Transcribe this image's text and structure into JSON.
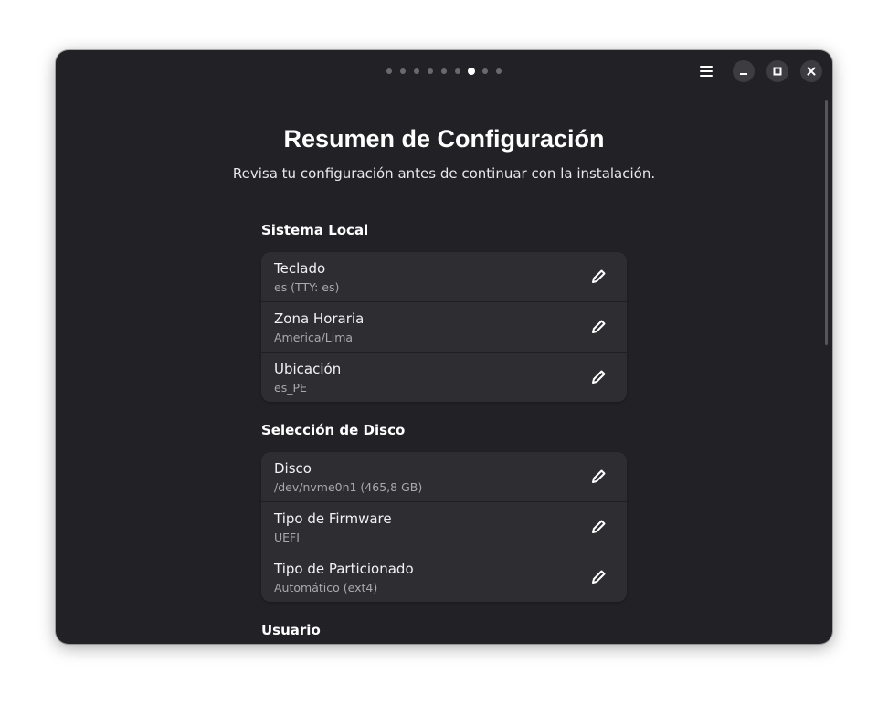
{
  "header": {
    "page_count": 9,
    "active_page": 6
  },
  "main": {
    "title": "Resumen de Configuración",
    "subtitle": "Revisa tu configuración antes de continuar con la instalación."
  },
  "sections": [
    {
      "title": "Sistema Local",
      "rows": [
        {
          "title": "Teclado",
          "value": "es (TTY: es)"
        },
        {
          "title": "Zona Horaria",
          "value": "America/Lima"
        },
        {
          "title": "Ubicación",
          "value": "es_PE"
        }
      ]
    },
    {
      "title": "Selección de Disco",
      "rows": [
        {
          "title": "Disco",
          "value": "/dev/nvme0n1 (465,8 GB)"
        },
        {
          "title": "Tipo de Firmware",
          "value": "UEFI"
        },
        {
          "title": "Tipo de Particionado",
          "value": "Automático (ext4)"
        }
      ]
    },
    {
      "title": "Usuario",
      "rows": []
    }
  ],
  "icons": {
    "menu": "hamburger-menu-icon",
    "minimize": "minimize-icon",
    "maximize": "maximize-icon",
    "close": "close-icon",
    "edit": "pencil-icon"
  },
  "colors": {
    "window_bg": "#222226",
    "card_bg": "#2e2e32",
    "text_primary": "#ffffff",
    "text_secondary": "#a8a8ad",
    "dot_inactive": "#6a6a6e",
    "dot_active": "#ffffff"
  }
}
